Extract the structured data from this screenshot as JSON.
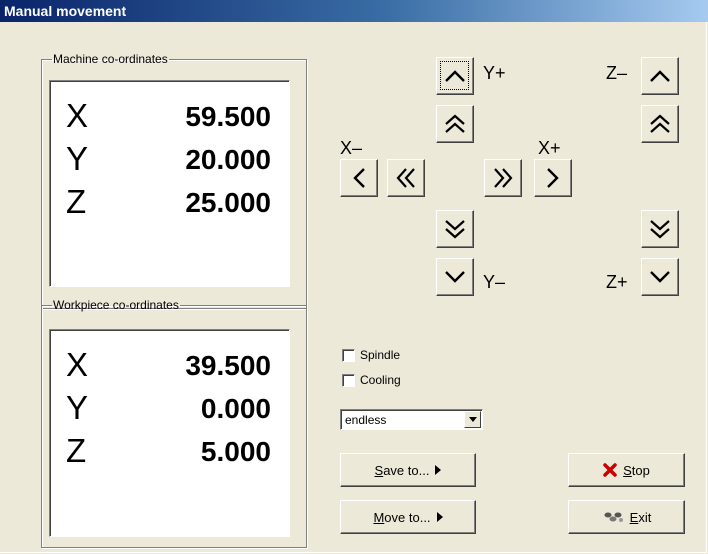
{
  "window": {
    "title": "Manual movement"
  },
  "machine": {
    "legend": "Machine co-ordinates",
    "rows": [
      {
        "axis": "X",
        "value": "59.500"
      },
      {
        "axis": "Y",
        "value": "20.000"
      },
      {
        "axis": "Z",
        "value": "25.000"
      }
    ]
  },
  "workpiece": {
    "legend": "Workpiece co-ordinates",
    "rows": [
      {
        "axis": "X",
        "value": "39.500"
      },
      {
        "axis": "Y",
        "value": "0.000"
      },
      {
        "axis": "Z",
        "value": "5.000"
      }
    ]
  },
  "jog": {
    "y_plus": "Y+",
    "y_minus": "Y–",
    "x_minus": "X–",
    "x_plus": "X+",
    "z_minus": "Z–",
    "z_plus": "Z+"
  },
  "options": {
    "spindle": "Spindle",
    "cooling": "Cooling",
    "spindle_checked": false,
    "cooling_checked": false
  },
  "mode_select": {
    "value": "endless"
  },
  "buttons": {
    "save_to": {
      "mnemonic": "S",
      "rest": "ave to..."
    },
    "move_to": {
      "mnemonic": "M",
      "rest": "ove to..."
    },
    "stop": {
      "mnemonic": "S",
      "rest": "top"
    },
    "exit": {
      "mnemonic": "E",
      "rest": "xit"
    }
  },
  "icons": {
    "stop": "red-x-icon",
    "exit": "exit-icon"
  },
  "colors": {
    "stop_icon": "#cc0000",
    "title_start": "#0a246a",
    "title_end": "#a6caf0"
  }
}
